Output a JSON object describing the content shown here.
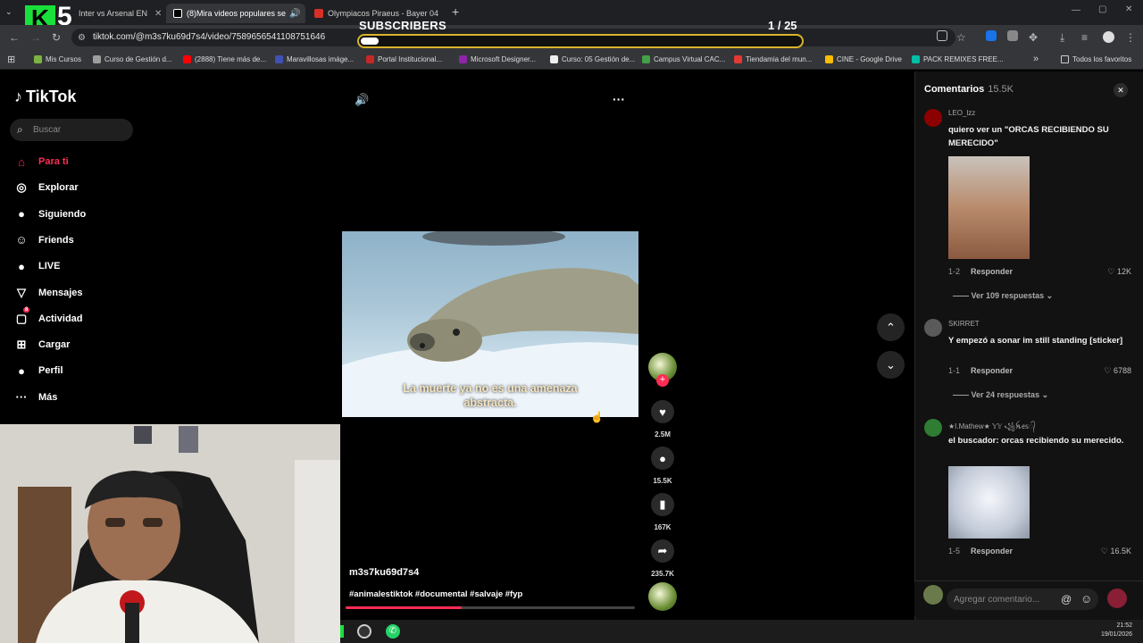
{
  "browser": {
    "tabs": [
      {
        "label": "Inter vs Arsenal EN",
        "color": "#1a73e8"
      },
      {
        "label": "(8)Mira videos populares se",
        "color": "#000000",
        "active": true
      },
      {
        "label": "Olympiacos Piraeus - Bayer 04",
        "color": "#d93025"
      }
    ],
    "new_tab": "+",
    "url": "tiktok.com/@m3s7ku69d7s4/video/7589656541108751646",
    "bookmarks": [
      {
        "label": "Mis Cursos",
        "color": "#7cb342"
      },
      {
        "label": "Curso de Gestión d...",
        "color": "#9e9e9e"
      },
      {
        "label": "(2888) Tiene más de...",
        "color": "#ff0000"
      },
      {
        "label": "Maravillosas imáge...",
        "color": "#3f51b5"
      },
      {
        "label": "Portal Institucional...",
        "color": "#c62828"
      },
      {
        "label": "Microsoft Designer...",
        "color": "#8e24aa"
      },
      {
        "label": "Curso: 05 Gestión de...",
        "color": "#eeeeee"
      },
      {
        "label": "Campus Virtual CAC...",
        "color": "#43a047"
      },
      {
        "label": "Tiendamia del mun...",
        "color": "#e53935"
      },
      {
        "label": "CINE - Google Drive",
        "color": "#fbbc04"
      },
      {
        "label": "PACK REMIXES FREE...",
        "color": "#00bfa5"
      }
    ],
    "favorites_label": "Todos los favoritos",
    "more_bookmarks": "»"
  },
  "overlay": {
    "logo_letter": "K",
    "logo_number": "5",
    "subscribers_label": "SUBSCRIBERS",
    "count_text": "1  / 25",
    "progress": 0.04,
    "bar_color": "#d9b42b"
  },
  "sidebar": {
    "brand": "TikTok",
    "search_placeholder": "Buscar",
    "items": [
      {
        "label": "Para ti",
        "icon": "home-icon",
        "glyph": "⌂",
        "active": true
      },
      {
        "label": "Explorar",
        "icon": "compass-icon",
        "glyph": "◎"
      },
      {
        "label": "Siguiendo",
        "icon": "following-icon",
        "glyph": "●"
      },
      {
        "label": "Friends",
        "icon": "friends-icon",
        "glyph": "☺"
      },
      {
        "label": "LIVE",
        "icon": "live-icon",
        "glyph": "●"
      },
      {
        "label": "Mensajes",
        "icon": "messages-icon",
        "glyph": "▽"
      },
      {
        "label": "Actividad",
        "icon": "activity-icon",
        "glyph": "▢",
        "badge": "8"
      },
      {
        "label": "Cargar",
        "icon": "upload-icon",
        "glyph": "⊞"
      },
      {
        "label": "Perfil",
        "icon": "profile-icon",
        "glyph": "●"
      },
      {
        "label": "Más",
        "icon": "more-icon",
        "glyph": "···"
      }
    ]
  },
  "video": {
    "caption_line1": "La muerte ya no es una amenaza",
    "caption_line2": "abstracta.",
    "author": "m3s7ku69d7s4",
    "hashtags": "#animalestiktok #documental #salvaje #fyp",
    "progress": 0.4,
    "more_glyph": "···",
    "volume_glyph": "🔊"
  },
  "actions": {
    "likes": "2.5M",
    "comments": "15.5K",
    "saves": "167K",
    "shares": "235.7K"
  },
  "comments": {
    "title": "Comentarios",
    "count": "15.5K",
    "input_placeholder": "Agregar comentario...",
    "reply_label": "Responder",
    "items": [
      {
        "user": "LEO_lzz",
        "text": "quiero ver un \"ORCAS RECIBIENDO SU MERECIDO\"",
        "date": "1-2",
        "likes": "12K",
        "replies": "Ver 109 respuestas",
        "avatar_color": "#8b0000"
      },
      {
        "user": "SKIRRET",
        "text": "Y empezó a sonar im still standing [sticker]",
        "date": "1-1",
        "likes": "6788",
        "replies": "Ver 24 respuestas",
        "avatar_color": "#5a5a5a"
      },
      {
        "user": "★I.Mathew★ 𝕐𝕐 ꧁ꫝꫀ𝕤᭄",
        "text": "el buscador: orcas recibiendo su merecido.",
        "date": "1-5",
        "likes": "16.5K",
        "replies": "",
        "avatar_color": "#2e7d32"
      }
    ]
  },
  "taskbar": {
    "time": "21:52",
    "date": "19/01/2026"
  }
}
